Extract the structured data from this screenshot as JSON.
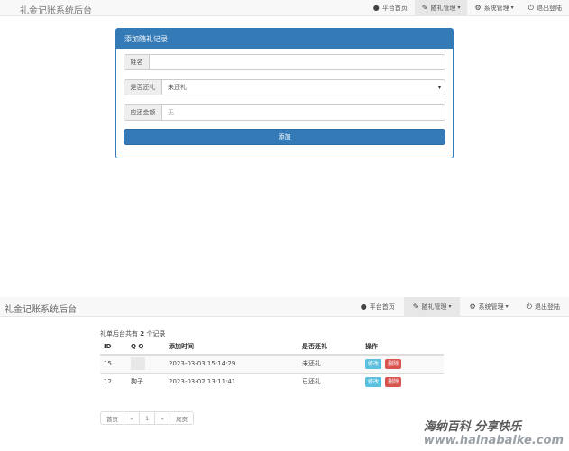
{
  "top_nav": {
    "brand": "礼金记账系统后台",
    "items": [
      {
        "icon": "user-icon",
        "glyph": "●",
        "label": "平台首页",
        "caret": ""
      },
      {
        "icon": "pin-icon",
        "glyph": "✎",
        "label": "随礼管理",
        "caret": "▾"
      },
      {
        "icon": "gear-icon",
        "glyph": "⚙",
        "label": "系统管理",
        "caret": "▾"
      },
      {
        "icon": "power-icon",
        "glyph": "⏻",
        "label": "退出登陆",
        "caret": ""
      }
    ]
  },
  "form": {
    "title": "添加随礼记录",
    "name_label": "姓名",
    "name_value": "",
    "returned_label": "是否还礼",
    "returned_value": "未还礼",
    "amount_label": "应还金额",
    "amount_placeholder": "无",
    "submit_label": "添加"
  },
  "bottom_nav": {
    "brand": "礼金记账系统后台",
    "items": [
      {
        "icon": "user-icon",
        "glyph": "●",
        "label": "平台首页",
        "caret": ""
      },
      {
        "icon": "pin-icon",
        "glyph": "✎",
        "label": "随礼管理",
        "caret": "▾"
      },
      {
        "icon": "gear-icon",
        "glyph": "⚙",
        "label": "系统管理",
        "caret": "▾"
      },
      {
        "icon": "power-icon",
        "glyph": "⏻",
        "label": "退出登陆",
        "caret": ""
      }
    ]
  },
  "list": {
    "summary_prefix": "礼单后台共有",
    "summary_count": "2",
    "summary_suffix": "个记录",
    "columns": [
      "ID",
      "Q Q",
      "添加时间",
      "是否还礼",
      "操作"
    ],
    "rows": [
      {
        "id": "15",
        "qq": "",
        "time": "2023-03-03 15:14:29",
        "returned": "未还礼",
        "edit": "修改",
        "delete": "删除"
      },
      {
        "id": "12",
        "qq": "狗子",
        "time": "2023-03-02 13:11:41",
        "returned": "已还礼",
        "edit": "修改",
        "delete": "删除"
      }
    ],
    "pagination": [
      "首页",
      "«",
      "1",
      "»",
      "尾页"
    ]
  },
  "watermark": {
    "main": "海纳百科 分享快乐",
    "url": "www.hainabaike.com"
  }
}
